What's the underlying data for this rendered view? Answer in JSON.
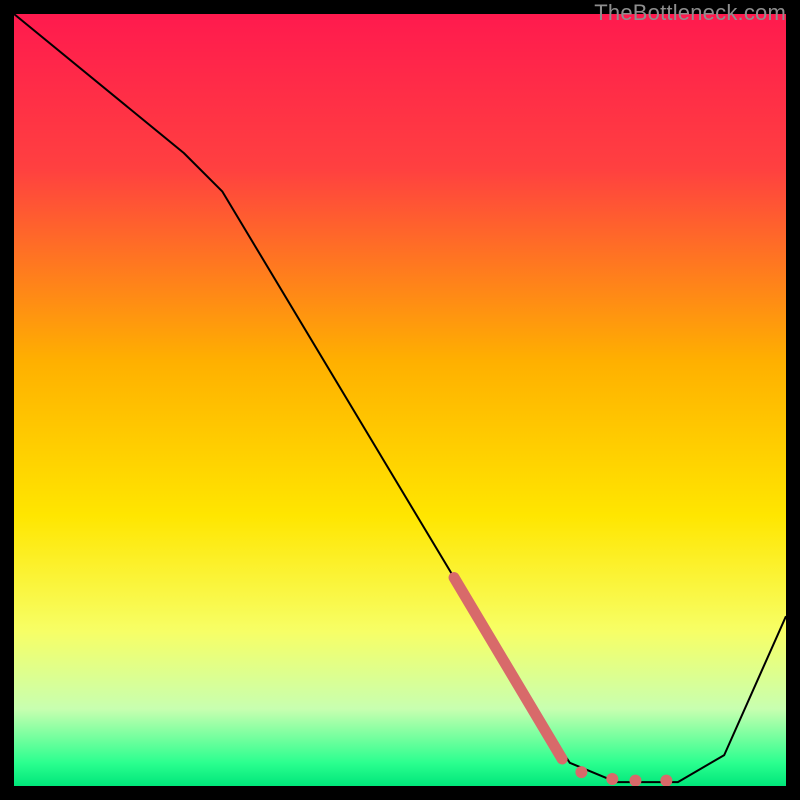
{
  "watermark": "TheBottleneck.com",
  "chart_data": {
    "type": "line",
    "title": "",
    "xlabel": "",
    "ylabel": "",
    "xlim": [
      0,
      100
    ],
    "ylim": [
      0,
      100
    ],
    "background_gradient_stops": [
      {
        "pct": 0,
        "color": "#ff1a4e"
      },
      {
        "pct": 20,
        "color": "#ff4040"
      },
      {
        "pct": 45,
        "color": "#ffb000"
      },
      {
        "pct": 65,
        "color": "#ffe600"
      },
      {
        "pct": 80,
        "color": "#f7ff66"
      },
      {
        "pct": 90,
        "color": "#c8ffb0"
      },
      {
        "pct": 97,
        "color": "#2bff8f"
      },
      {
        "pct": 100,
        "color": "#00e67a"
      }
    ],
    "series": [
      {
        "name": "curve",
        "stroke": "#000000",
        "stroke_width": 2,
        "points": [
          {
            "x": 0,
            "y": 100
          },
          {
            "x": 22,
            "y": 82
          },
          {
            "x": 27,
            "y": 77
          },
          {
            "x": 66,
            "y": 12
          },
          {
            "x": 72,
            "y": 3
          },
          {
            "x": 78,
            "y": 0.5
          },
          {
            "x": 86,
            "y": 0.5
          },
          {
            "x": 92,
            "y": 4
          },
          {
            "x": 100,
            "y": 22
          }
        ]
      }
    ],
    "highlight_segment": {
      "name": "highlight-bar",
      "stroke": "#d86a6a",
      "stroke_width": 11,
      "points": [
        {
          "x": 57,
          "y": 27
        },
        {
          "x": 71,
          "y": 3.5
        }
      ]
    },
    "highlight_dots": {
      "name": "highlight-dots",
      "fill": "#d86a6a",
      "radius": 6,
      "points": [
        {
          "x": 73.5,
          "y": 1.8
        },
        {
          "x": 77.5,
          "y": 0.9
        },
        {
          "x": 80.5,
          "y": 0.7
        },
        {
          "x": 84.5,
          "y": 0.7
        }
      ]
    }
  }
}
